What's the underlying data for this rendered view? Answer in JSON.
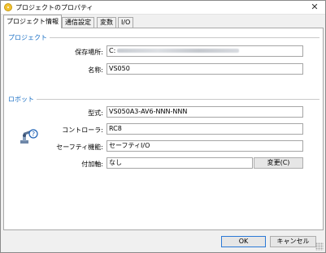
{
  "window": {
    "title": "プロジェクトのプロパティ",
    "close_glyph": "✕"
  },
  "tabs": [
    {
      "label": "プロジェクト情報",
      "active": true
    },
    {
      "label": "通信設定",
      "active": false
    },
    {
      "label": "変数",
      "active": false
    },
    {
      "label": "I/O",
      "active": false
    }
  ],
  "project": {
    "group_title": "プロジェクト",
    "save_location_label": "保存場所:",
    "save_location_value": "C:",
    "name_label": "名称:",
    "name_value": "VS050"
  },
  "robot": {
    "group_title": "ロボット",
    "icon": "robot-arm-icon",
    "model_label": "型式:",
    "model_value": "VS050A3-AV6-NNN-NNN",
    "controller_label": "コントローラ:",
    "controller_value": "RC8",
    "safety_label": "セーフティ機能:",
    "safety_value": "セーフティI/O",
    "addon_label": "付加軸:",
    "addon_value": "なし",
    "change_button": "変更(C)"
  },
  "footer": {
    "ok_label": "OK",
    "cancel_label": "キャンセル"
  },
  "colors": {
    "group_title": "#1a6fc4",
    "default_button_border": "#2b79d6"
  }
}
